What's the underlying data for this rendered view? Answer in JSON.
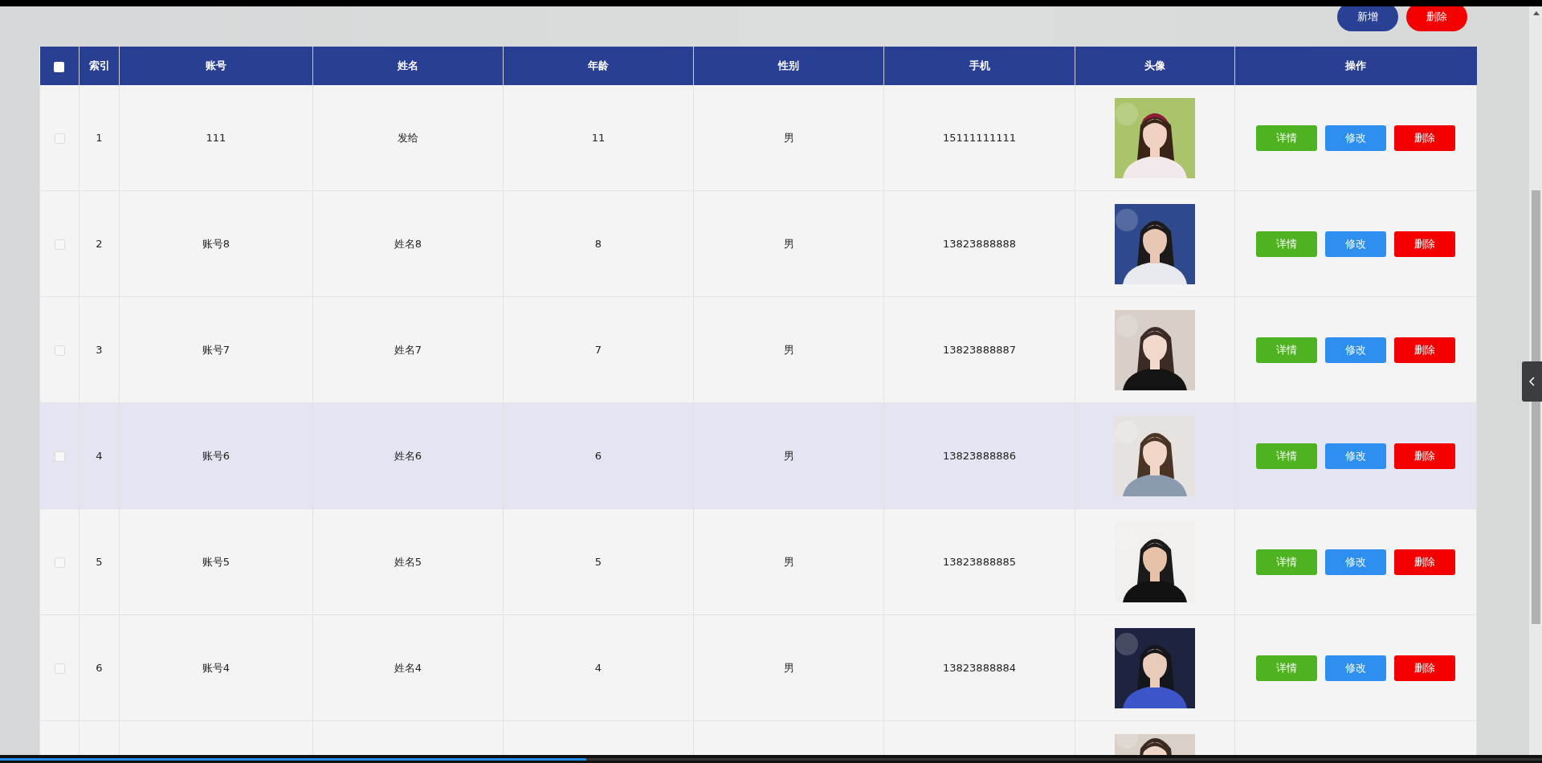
{
  "toolbar": {
    "buttons": [
      {
        "label": "新增",
        "kind": "add"
      },
      {
        "label": "删除",
        "kind": "delete"
      }
    ]
  },
  "table": {
    "select_all": {
      "checked": false
    },
    "columns": [
      "索引",
      "账号",
      "姓名",
      "年龄",
      "性别",
      "手机",
      "头像",
      "操作"
    ],
    "rows": [
      {
        "index": "1",
        "account": "111",
        "name": "发给",
        "age": "11",
        "gender": "男",
        "phone": "15111111111",
        "checked": false,
        "highlighted": false,
        "actions": [
          {
            "label": "详情",
            "kind": "detail"
          },
          {
            "label": "修改",
            "kind": "edit"
          },
          {
            "label": "删除",
            "kind": "delete"
          }
        ]
      },
      {
        "index": "2",
        "account": "账号8",
        "name": "姓名8",
        "age": "8",
        "gender": "男",
        "phone": "13823888888",
        "checked": false,
        "highlighted": false,
        "actions": [
          {
            "label": "详情",
            "kind": "detail"
          },
          {
            "label": "修改",
            "kind": "edit"
          },
          {
            "label": "删除",
            "kind": "delete"
          }
        ]
      },
      {
        "index": "3",
        "account": "账号7",
        "name": "姓名7",
        "age": "7",
        "gender": "男",
        "phone": "13823888887",
        "checked": false,
        "highlighted": false,
        "actions": [
          {
            "label": "详情",
            "kind": "detail"
          },
          {
            "label": "修改",
            "kind": "edit"
          },
          {
            "label": "删除",
            "kind": "delete"
          }
        ]
      },
      {
        "index": "4",
        "account": "账号6",
        "name": "姓名6",
        "age": "6",
        "gender": "男",
        "phone": "13823888886",
        "checked": false,
        "highlighted": true,
        "actions": [
          {
            "label": "详情",
            "kind": "detail"
          },
          {
            "label": "修改",
            "kind": "edit"
          },
          {
            "label": "删除",
            "kind": "delete"
          }
        ]
      },
      {
        "index": "5",
        "account": "账号5",
        "name": "姓名5",
        "age": "5",
        "gender": "男",
        "phone": "13823888885",
        "checked": false,
        "highlighted": false,
        "actions": [
          {
            "label": "详情",
            "kind": "detail"
          },
          {
            "label": "修改",
            "kind": "edit"
          },
          {
            "label": "删除",
            "kind": "delete"
          }
        ]
      },
      {
        "index": "6",
        "account": "账号4",
        "name": "姓名4",
        "age": "4",
        "gender": "男",
        "phone": "13823888884",
        "checked": false,
        "highlighted": false,
        "actions": [
          {
            "label": "详情",
            "kind": "detail"
          },
          {
            "label": "修改",
            "kind": "edit"
          },
          {
            "label": "删除",
            "kind": "delete"
          }
        ]
      }
    ]
  },
  "video_progress": {
    "level": 0.38
  }
}
